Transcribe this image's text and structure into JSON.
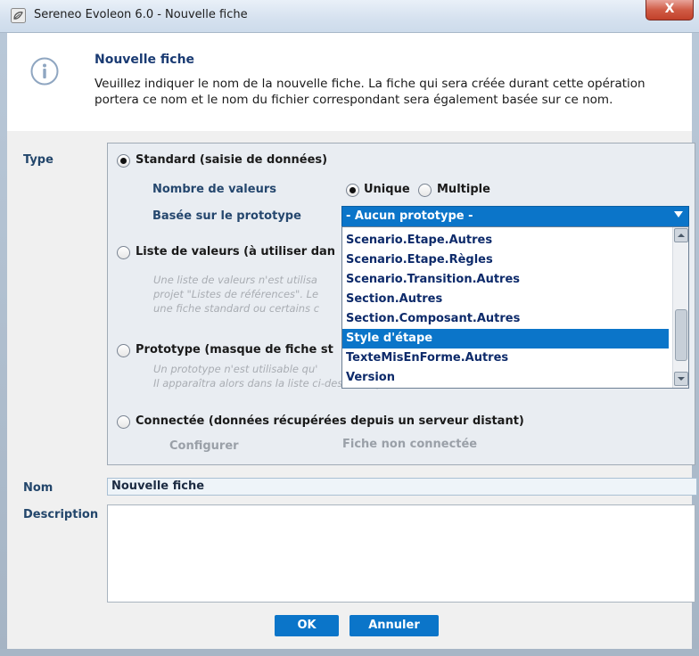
{
  "window": {
    "title": "Sereneo Evoleon 6.0 - Nouvelle fiche",
    "close_glyph": "X"
  },
  "header": {
    "title": "Nouvelle fiche",
    "text": "Veuillez indiquer le nom de la nouvelle fiche. La fiche qui sera créée durant cette opération portera ce nom et le nom du fichier correspondant sera également basée sur ce nom.",
    "icon": "info-icon"
  },
  "labels": {
    "type": "Type",
    "nom": "Nom",
    "description": "Description"
  },
  "type_options": {
    "standard": {
      "label": "Standard (saisie de données)",
      "checked": true,
      "nombre_label": "Nombre de valeurs",
      "unique_label": "Unique",
      "multiple_label": "Multiple",
      "unique_checked": true,
      "prototype_label": "Basée sur le prototype"
    },
    "liste": {
      "label": "Liste de valeurs (à utiliser dan",
      "desc_lines": [
        "Une liste de valeurs n'est utilisa",
        "projet \"Listes de références\". Le",
        "une fiche standard ou certains c"
      ]
    },
    "prototype": {
      "label": "Prototype (masque de fiche st",
      "desc_lines": [
        "Un prototype n'est utilisable qu'",
        "Il apparaîtra alors dans la liste ci-dessus et pourra servir de base à une fiche standard."
      ]
    },
    "connectee": {
      "label": "Connectée (données récupérées depuis un serveur distant)",
      "configure_label": "Configurer",
      "status": "Fiche non connectée"
    }
  },
  "prototype_select": {
    "value": "- Aucun prototype -",
    "items": [
      "Scenario.Etape.Autres",
      "Scenario.Etape.Règles",
      "Scenario.Transition.Autres",
      "Section.Autres",
      "Section.Composant.Autres",
      "Style d'étape",
      "TexteMisEnForme.Autres",
      "Version"
    ],
    "selected_index": 5
  },
  "form": {
    "nom_value": "Nouvelle fiche",
    "description_value": ""
  },
  "buttons": {
    "ok": "OK",
    "cancel": "Annuler"
  },
  "colors": {
    "accent": "#0b75c9",
    "label": "#23466b"
  }
}
